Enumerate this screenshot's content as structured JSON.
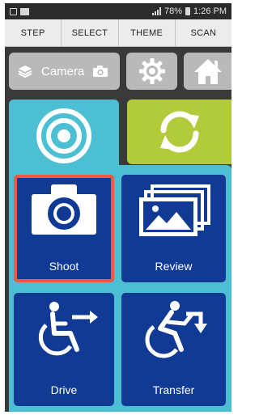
{
  "status_bar": {
    "battery_percent": "78%",
    "time": "1:26 PM"
  },
  "menu": [
    {
      "label": "STEP"
    },
    {
      "label": "SELECT"
    },
    {
      "label": "THEME"
    },
    {
      "label": "SCAN"
    }
  ],
  "toolbar": {
    "mode_label": "Camera",
    "mode_icon": "layers-icon",
    "mode_right_icon": "camera-icon",
    "settings_icon": "gear-icon",
    "home_icon": "home-icon"
  },
  "tabs": {
    "active_icon": "target-icon",
    "inactive_icon": "refresh-icon"
  },
  "tiles": [
    {
      "label": "Shoot",
      "icon": "camera-icon",
      "selected": true
    },
    {
      "label": "Review",
      "icon": "photos-icon",
      "selected": false
    },
    {
      "label": "Drive",
      "icon": "wheelchair-arrow-icon",
      "selected": false
    },
    {
      "label": "Transfer",
      "icon": "wheelchair-transfer-icon",
      "selected": false
    }
  ],
  "colors": {
    "background": "#3a3a3a",
    "tab_active": "#4dbfd3",
    "tab_inactive": "#b2cb3b",
    "tile": "#113a94",
    "selection": "#f25a3c",
    "button_grey": "#b9b9b9"
  }
}
